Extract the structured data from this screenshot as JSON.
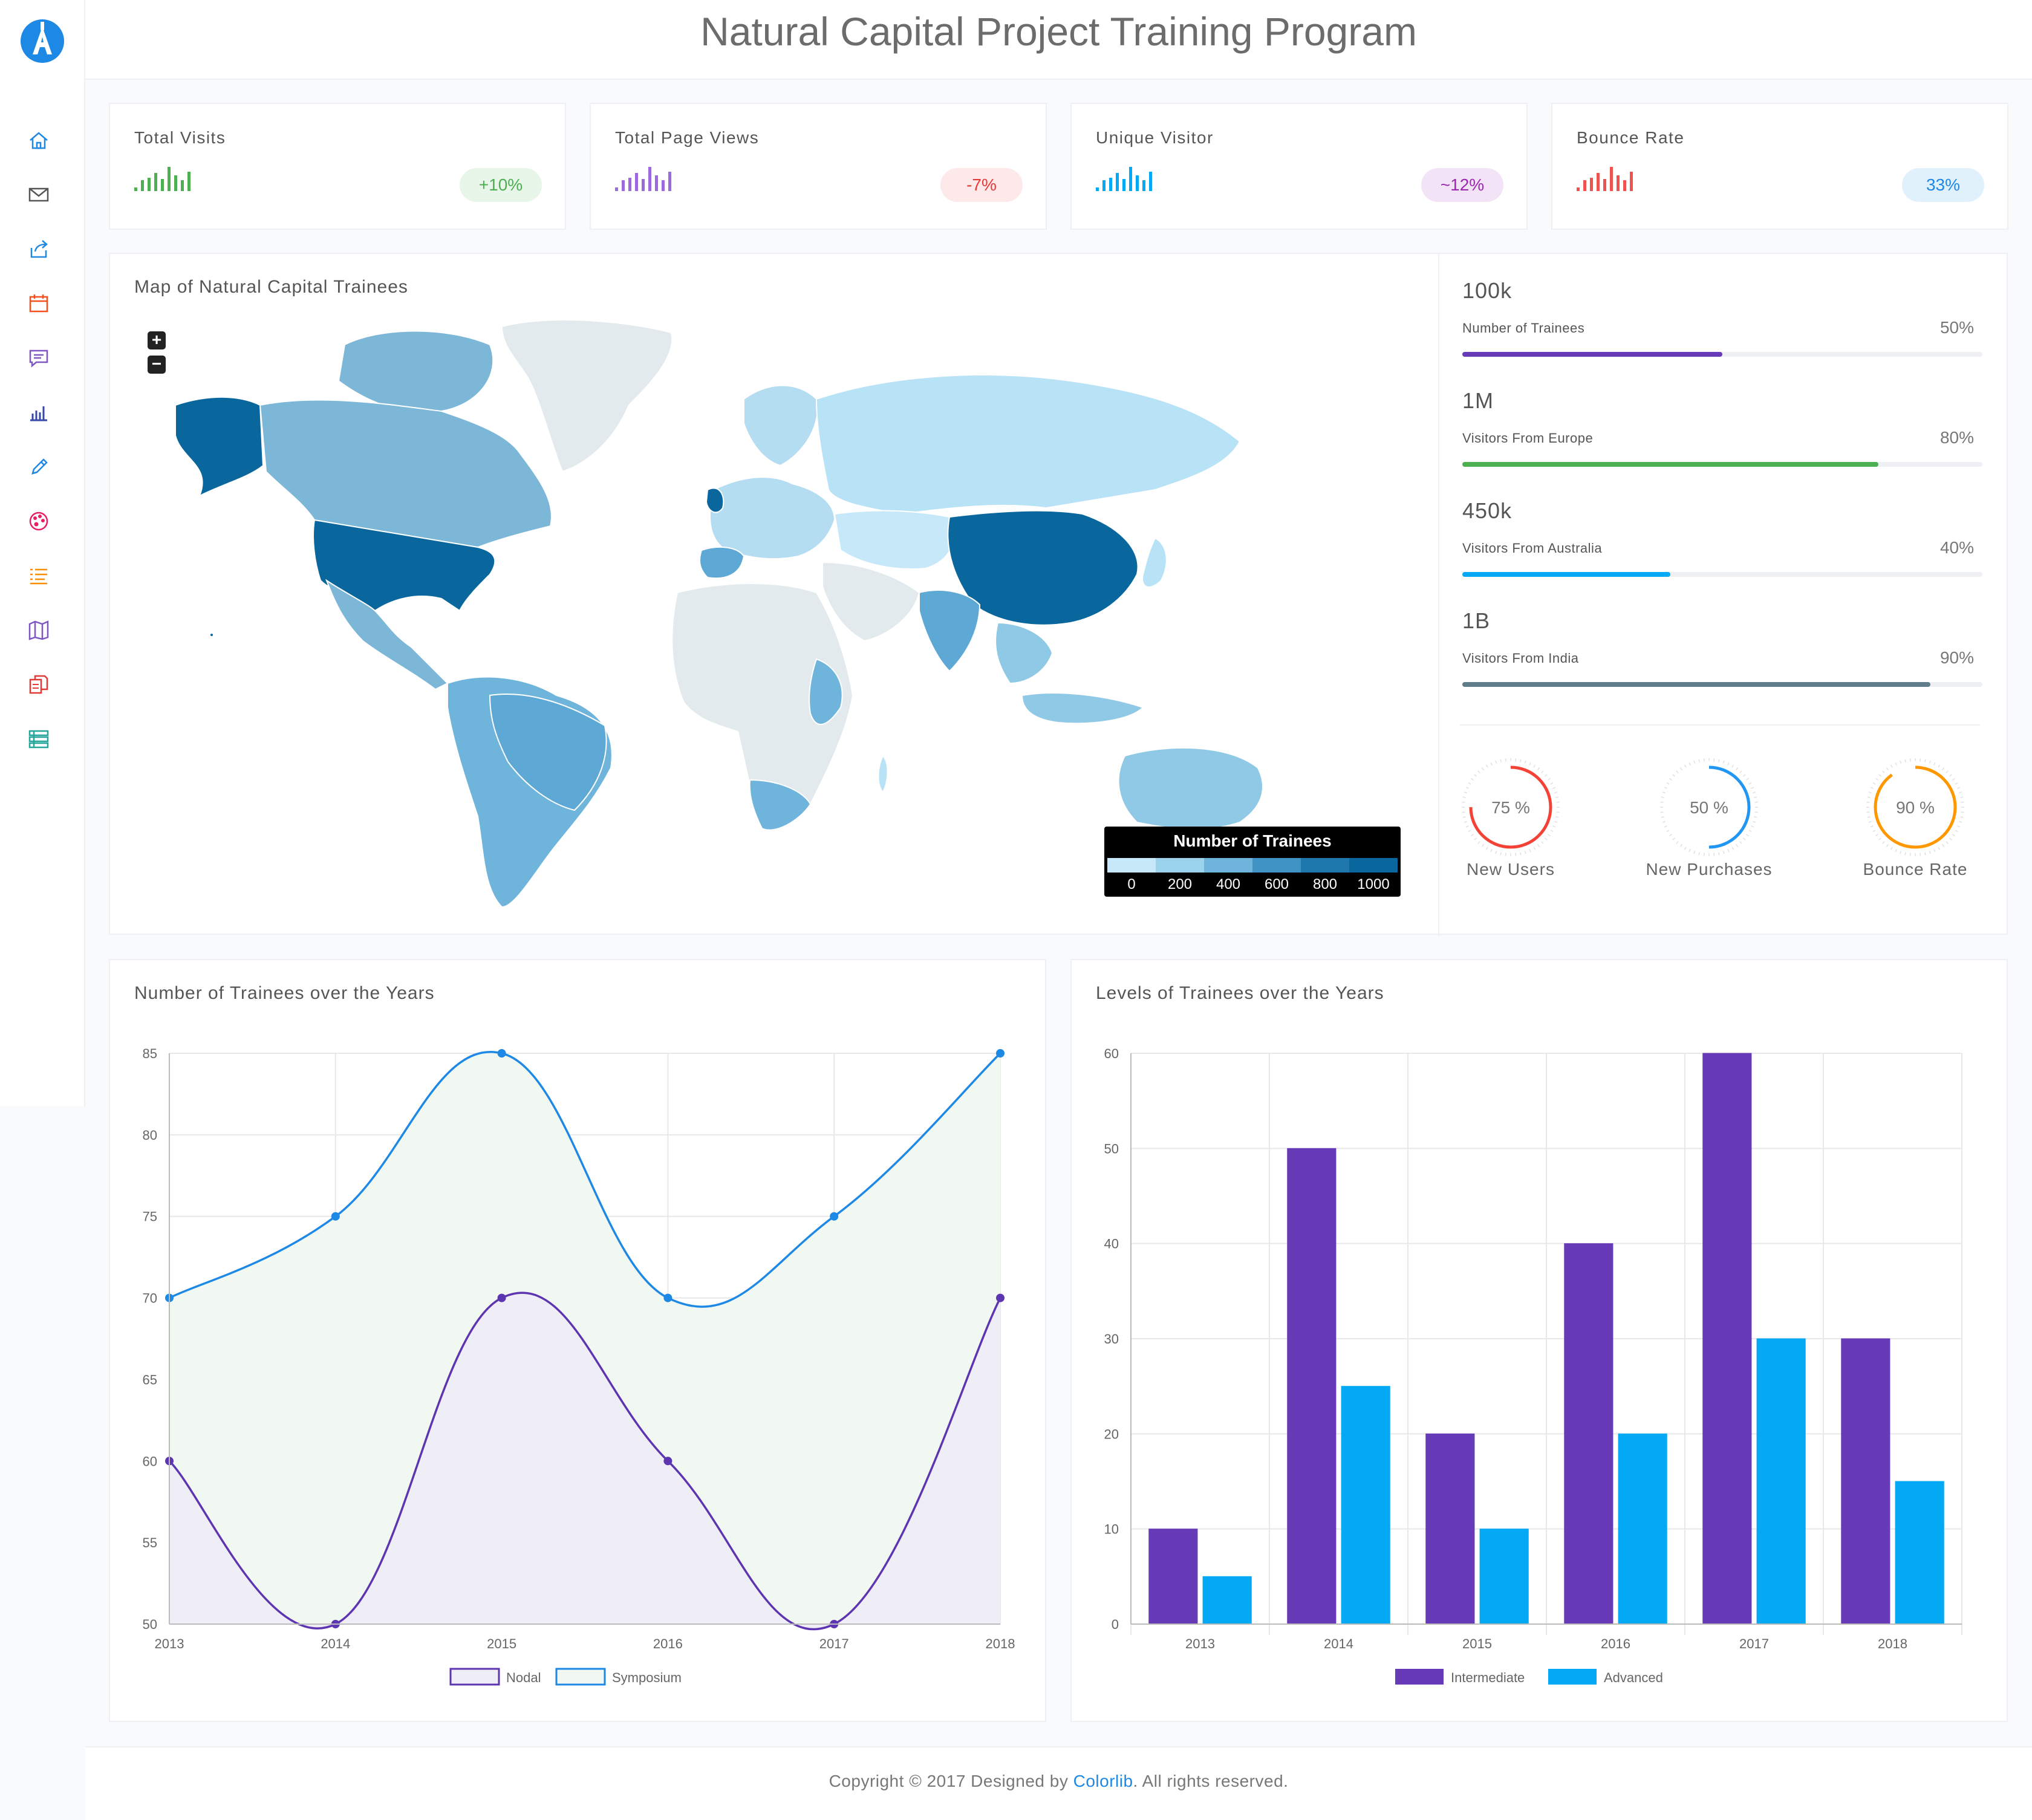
{
  "app": {
    "title": "Natural Capital Project Training Program"
  },
  "sidebar": {
    "logo_icon": "a-letter-logo-icon",
    "items": [
      {
        "icon": "home-icon",
        "color": "#1e88e5"
      },
      {
        "icon": "envelope-icon",
        "color": "#555555"
      },
      {
        "icon": "share-icon",
        "color": "#1e88e5"
      },
      {
        "icon": "calendar-icon",
        "color": "#f4511e"
      },
      {
        "icon": "chat-icon",
        "color": "#7e57c2"
      },
      {
        "icon": "bar-chart-icon",
        "color": "#3949ab"
      },
      {
        "icon": "pencil-icon",
        "color": "#1e88e5"
      },
      {
        "icon": "palette-icon",
        "color": "#e91e63"
      },
      {
        "icon": "list-icon",
        "color": "#fb8c00"
      },
      {
        "icon": "map-icon",
        "color": "#7e57c2"
      },
      {
        "icon": "pages-icon",
        "color": "#e53935"
      },
      {
        "icon": "table-icon",
        "color": "#26a69a"
      }
    ]
  },
  "stats": [
    {
      "title": "Total Visits",
      "badge": "+10%",
      "color": "#4caf50",
      "badge_bg": "#e8f5e9",
      "bars": [
        0.15,
        0.45,
        0.55,
        0.75,
        0.5,
        1.0,
        0.65,
        0.45,
        0.8
      ]
    },
    {
      "title": "Total Page Views",
      "badge": "-7%",
      "color": "#9c6ade",
      "badge_bg": "#fde8ea",
      "badge_color": "#e53935",
      "bars": [
        0.15,
        0.45,
        0.55,
        0.75,
        0.5,
        1.0,
        0.65,
        0.45,
        0.8
      ]
    },
    {
      "title": "Unique Visitor",
      "badge": "~12%",
      "color": "#03a9f4",
      "badge_bg": "#f3e3f6",
      "badge_color": "#9c27b0",
      "bars": [
        0.15,
        0.45,
        0.55,
        0.75,
        0.5,
        1.0,
        0.65,
        0.45,
        0.8
      ]
    },
    {
      "title": "Bounce Rate",
      "badge": "33%",
      "color": "#ef5350",
      "badge_bg": "#e1f1fc",
      "badge_color": "#1e88e5",
      "bars": [
        0.15,
        0.45,
        0.55,
        0.75,
        0.5,
        1.0,
        0.65,
        0.45,
        0.8
      ]
    }
  ],
  "map": {
    "title": "Map of Natural Capital Trainees",
    "zoom_in": "+",
    "zoom_out": "−",
    "legend_title": "Number of Trainees",
    "legend_ticks": [
      "0",
      "200",
      "400",
      "600",
      "800",
      "1000"
    ],
    "legend_colors": [
      "#c6e8f8",
      "#9cd3ec",
      "#6fb5db",
      "#3f94c5",
      "#1f78ad",
      "#0a679e"
    ]
  },
  "progress": [
    {
      "value": "100k",
      "label": "Number of Trainees",
      "pct_text": "50%",
      "pct": 0.5,
      "color": "#673ab7"
    },
    {
      "value": "1M",
      "label": "Visitors From Europe",
      "pct_text": "80%",
      "pct": 0.8,
      "color": "#4caf50"
    },
    {
      "value": "450k",
      "label": "Visitors From Australia",
      "pct_text": "40%",
      "pct": 0.4,
      "color": "#03a9f4"
    },
    {
      "value": "1B",
      "label": "Visitors From India",
      "pct_text": "90%",
      "pct": 0.9,
      "color": "#607d8b"
    }
  ],
  "gauges": [
    {
      "text": "75 %",
      "label": "New Users",
      "pct": 0.75,
      "color": "#f44336"
    },
    {
      "text": "50 %",
      "label": "New Purchases",
      "pct": 0.5,
      "color": "#2196f3"
    },
    {
      "text": "90 %",
      "label": "Bounce Rate",
      "pct": 0.9,
      "color": "#ff9800"
    }
  ],
  "line_chart_title": "Number of Trainees over the Years",
  "bar_chart_title": "Levels of Trainees over the Years",
  "chart_data": [
    {
      "type": "line",
      "title": "Number of Trainees over the Years",
      "x": [
        "2013",
        "2014",
        "2015",
        "2016",
        "2017",
        "2018"
      ],
      "ylim": [
        50,
        85
      ],
      "yticks": [
        50,
        55,
        60,
        65,
        70,
        75,
        80,
        85
      ],
      "grid": true,
      "legend": "bottom",
      "series": [
        {
          "name": "Nodal",
          "values": [
            60,
            50,
            70,
            60,
            50,
            70
          ],
          "color": "#5e35b1",
          "fill": "#efedf5"
        },
        {
          "name": "Symposium",
          "values": [
            70,
            75,
            85,
            70,
            75,
            85
          ],
          "color": "#1e88e5",
          "fill": "#f1f8f2"
        }
      ]
    },
    {
      "type": "bar",
      "title": "Levels of Trainees over the Years",
      "categories": [
        "2013",
        "2014",
        "2015",
        "2016",
        "2017",
        "2018"
      ],
      "ylim": [
        0,
        60
      ],
      "yticks": [
        0,
        10,
        20,
        30,
        40,
        50,
        60
      ],
      "grid": true,
      "legend": "bottom",
      "series": [
        {
          "name": "Intermediate",
          "values": [
            10,
            50,
            20,
            40,
            60,
            30
          ],
          "color": "#673ab7"
        },
        {
          "name": "Advanced",
          "values": [
            5,
            25,
            10,
            20,
            30,
            15
          ],
          "color": "#03a9f4"
        }
      ]
    }
  ],
  "footer": {
    "prefix": "Copyright © 2017 Designed by ",
    "link": "Colorlib",
    "suffix": ". All rights reserved."
  }
}
